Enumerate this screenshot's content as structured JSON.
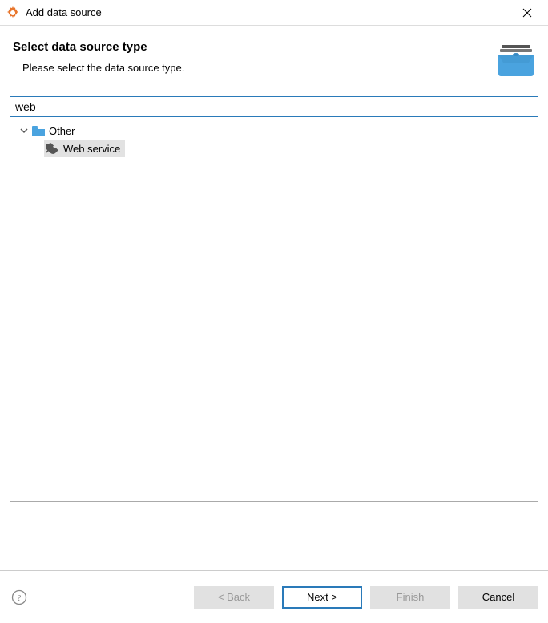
{
  "window": {
    "title": "Add data source"
  },
  "header": {
    "title": "Select data source type",
    "subtitle": "Please select the data source type."
  },
  "search": {
    "value": "web"
  },
  "tree": {
    "group_label": "Other",
    "item_label": "Web service"
  },
  "footer": {
    "back": "< Back",
    "next": "Next >",
    "finish": "Finish",
    "cancel": "Cancel"
  }
}
